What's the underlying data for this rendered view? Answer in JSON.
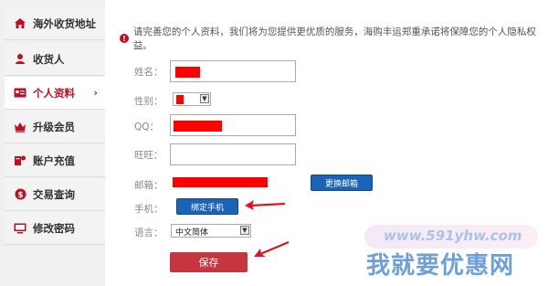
{
  "sidebar": {
    "items": [
      {
        "label": "海外收货地址",
        "icon": "home-icon",
        "active": false
      },
      {
        "label": "收货人",
        "icon": "user-icon",
        "active": false
      },
      {
        "label": "个人资料",
        "icon": "id-card-icon",
        "active": true,
        "chevron": "›"
      },
      {
        "label": "升级会员",
        "icon": "crown-icon",
        "active": false
      },
      {
        "label": "账户充值",
        "icon": "recharge-icon",
        "active": false
      },
      {
        "label": "交易查询",
        "icon": "dollar-icon",
        "active": false
      },
      {
        "label": "修改密码",
        "icon": "monitor-icon",
        "active": false
      }
    ]
  },
  "notice": {
    "icon": "!",
    "text": "请完善您的个人资料，我们将为您提供更优质的服务，海购丰运郑重承诺将保障您的个人隐私权益。"
  },
  "form": {
    "name_label": "姓名：",
    "gender_label": "性别：",
    "qq_label": "QQ：",
    "wangwang_label": "旺旺：",
    "email_label": "邮箱：",
    "phone_label": "手机：",
    "language_label": "语言：",
    "language_value": "中文简体",
    "change_email_button": "更换邮箱",
    "bind_phone_button": "绑定手机",
    "save_button": "保存"
  },
  "watermark": {
    "url": "www.591yhw.com",
    "title": "我就要优惠网"
  },
  "colors": {
    "accent": "#c30d23",
    "redaction": "#ff0000",
    "button_blue": "#1b63b7",
    "button_red": "#c7363f"
  }
}
